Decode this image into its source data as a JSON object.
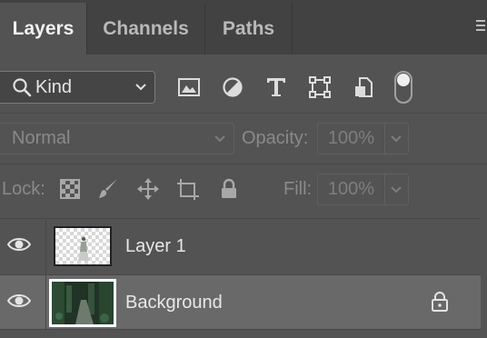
{
  "tabs": [
    {
      "label": "Layers",
      "active": true
    },
    {
      "label": "Channels",
      "active": false
    },
    {
      "label": "Paths",
      "active": false
    }
  ],
  "filter": {
    "kind_label": "Kind",
    "icons": [
      "pixel-layer-filter-icon",
      "adjustment-layer-filter-icon",
      "type-layer-filter-icon",
      "shape-layer-filter-icon",
      "smart-object-filter-icon"
    ],
    "toggle_on": true
  },
  "blend": {
    "mode": "Normal",
    "opacity_label": "Opacity:",
    "opacity_value": "100%"
  },
  "lock": {
    "label": "Lock:",
    "icons": [
      "lock-transparent-pixels-icon",
      "lock-image-pixels-icon",
      "lock-position-icon",
      "lock-artboard-icon",
      "lock-all-icon"
    ],
    "fill_label": "Fill:",
    "fill_value": "100%"
  },
  "layers": [
    {
      "name": "Layer 1",
      "visible": true,
      "selected": false,
      "locked": false
    },
    {
      "name": "Background",
      "visible": true,
      "selected": true,
      "locked": true
    }
  ],
  "colors": {
    "panel": "#535353",
    "tabbar": "#424242",
    "selected_row": "#696969"
  }
}
